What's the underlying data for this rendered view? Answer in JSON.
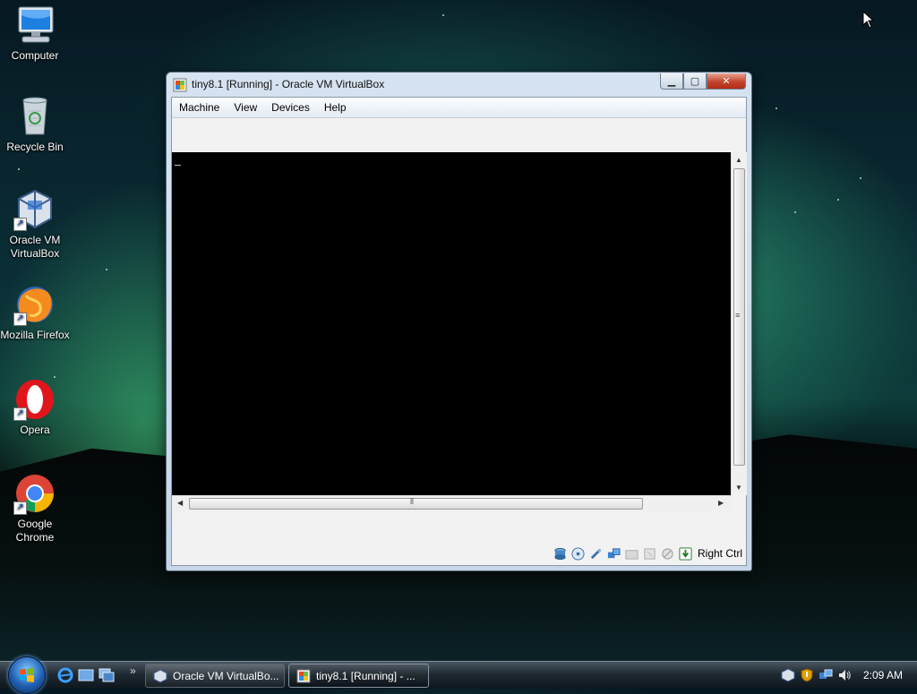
{
  "desktop": {
    "icons": [
      {
        "label": "Computer",
        "icon": "computer-icon"
      },
      {
        "label": "Recycle Bin",
        "icon": "recycle-bin-icon"
      },
      {
        "label": "Oracle VM VirtualBox",
        "icon": "virtualbox-icon"
      },
      {
        "label": "Mozilla Firefox",
        "icon": "firefox-icon"
      },
      {
        "label": "Opera",
        "icon": "opera-icon"
      },
      {
        "label": "Google Chrome",
        "icon": "chrome-icon"
      }
    ]
  },
  "window": {
    "title": "tiny8.1 [Running] - Oracle VM VirtualBox",
    "buttons": {
      "minimize": "minimize-icon",
      "maximize": "maximize-icon",
      "close": "close-icon"
    },
    "menu": [
      "Machine",
      "View",
      "Devices",
      "Help"
    ],
    "status_icons": [
      "hard-disk-icon",
      "optical-drive-icon",
      "usb-icon",
      "network-icon",
      "shared-folders-icon",
      "display-icon",
      "video-capture-icon",
      "mouse-integration-icon",
      "keyboard-capture-icon"
    ],
    "host_key": "Right Ctrl"
  },
  "taskbar": {
    "quick_launch": [
      "internet-explorer-icon",
      "show-desktop-icon",
      "switch-windows-icon"
    ],
    "buttons": [
      {
        "label": "Oracle VM VirtualBo...",
        "icon": "virtualbox-icon",
        "active": false
      },
      {
        "label": "tiny8.1 [Running] - ...",
        "icon": "vm-running-icon",
        "active": true
      }
    ],
    "clock": "2:09 AM"
  },
  "colors": {
    "window_frame": "#c6d6e8",
    "vm_screen": "#000000",
    "close_button": "#c2442c",
    "taskbar": "#1f2a33"
  }
}
